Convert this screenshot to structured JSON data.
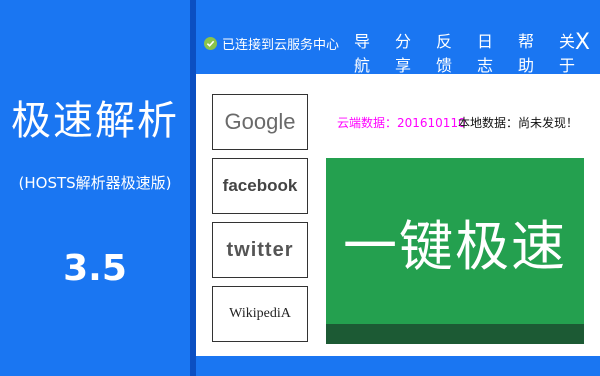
{
  "brand": {
    "title": "极速解析",
    "subtitle": "(HOSTS解析器极速版)",
    "version": "3.5"
  },
  "header": {
    "status": "已连接到云服务中心",
    "nav": [
      "导航",
      "分享",
      "反馈",
      "日志",
      "帮助",
      "关于"
    ],
    "close_label": "X"
  },
  "sites": {
    "google": "Google",
    "facebook": "facebook",
    "twitter": "twitter",
    "wikipedia": "WikipediA"
  },
  "data_info": {
    "cloud": "云端数据：201610110",
    "local": "本地数据：尚未发现！"
  },
  "boost_button": {
    "label": "一键极速"
  },
  "colors": {
    "primary_blue": "#1a76f2",
    "boost_green": "#24a04f",
    "cloud_text": "#ff00ff"
  },
  "icons": [
    "check-icon",
    "close-icon"
  ]
}
